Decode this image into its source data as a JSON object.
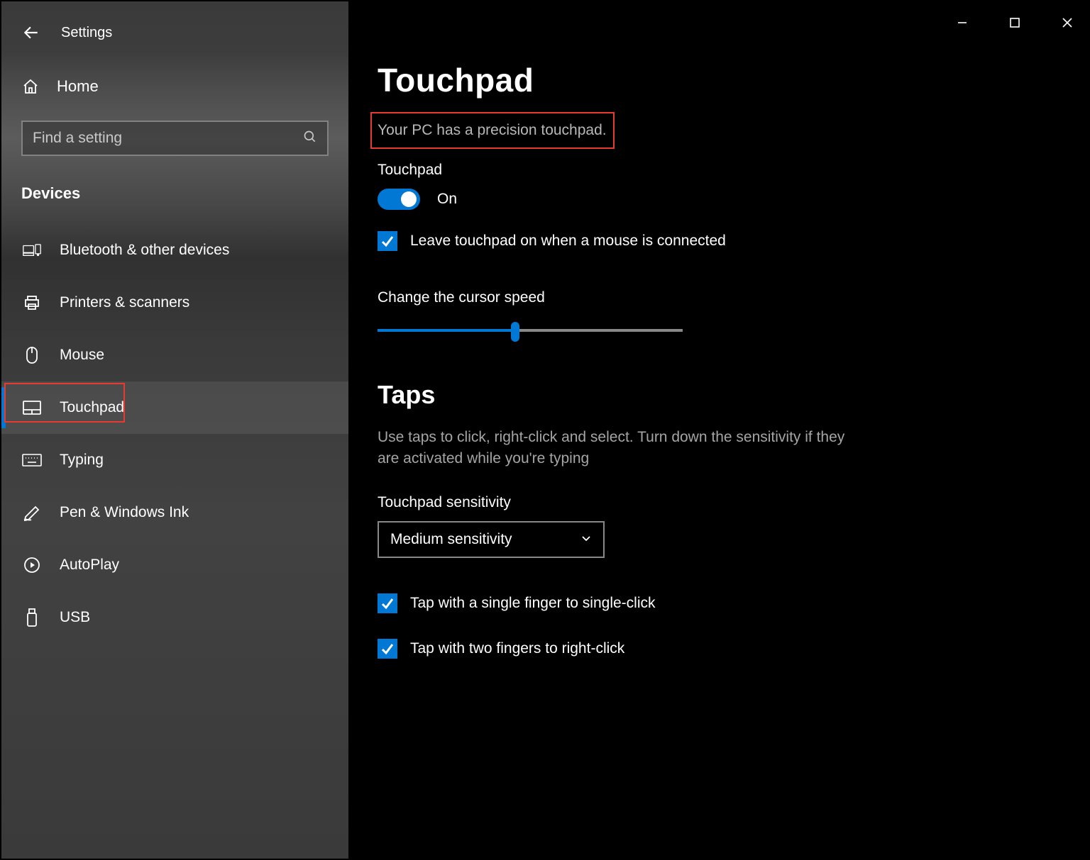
{
  "header": {
    "title": "Settings"
  },
  "sidebar": {
    "home_label": "Home",
    "search_placeholder": "Find a setting",
    "section_label": "Devices",
    "items": [
      {
        "icon": "bluetooth-devices-icon",
        "label": "Bluetooth & other devices"
      },
      {
        "icon": "printer-icon",
        "label": "Printers & scanners"
      },
      {
        "icon": "mouse-icon",
        "label": "Mouse"
      },
      {
        "icon": "touchpad-icon",
        "label": "Touchpad",
        "selected": true
      },
      {
        "icon": "keyboard-icon",
        "label": "Typing"
      },
      {
        "icon": "pen-icon",
        "label": "Pen & Windows Ink"
      },
      {
        "icon": "autoplay-icon",
        "label": "AutoPlay"
      },
      {
        "icon": "usb-icon",
        "label": "USB"
      }
    ]
  },
  "main": {
    "title": "Touchpad",
    "precision_message": "Your PC has a precision touchpad.",
    "touchpad_label": "Touchpad",
    "toggle_state_label": "On",
    "toggle_on": true,
    "leave_on_label": "Leave touchpad on when a mouse is connected",
    "leave_on_checked": true,
    "cursor_speed_label": "Change the cursor speed",
    "cursor_speed_pct": 45,
    "taps": {
      "title": "Taps",
      "description": "Use taps to click, right-click and select. Turn down the sensitivity if they are activated while you're typing",
      "sensitivity_label": "Touchpad sensitivity",
      "sensitivity_value": "Medium sensitivity",
      "single_tap_label": "Tap with a single finger to single-click",
      "single_tap_checked": true,
      "two_finger_tap_label": "Tap with two fingers to right-click",
      "two_finger_tap_checked": true
    }
  },
  "colors": {
    "accent": "#0078d4",
    "highlight_box": "#e63b2e"
  }
}
